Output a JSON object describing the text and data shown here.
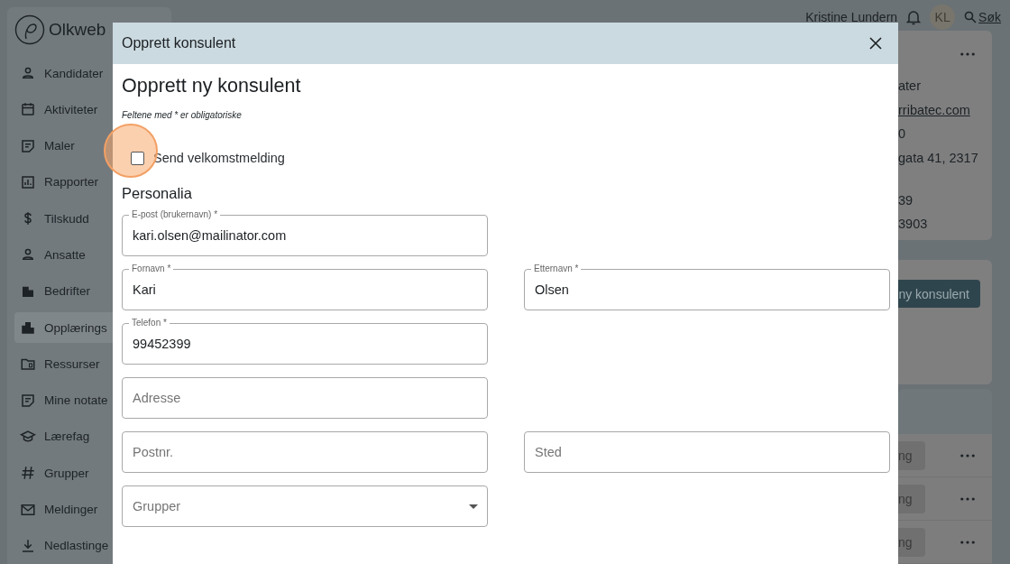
{
  "sidebar": {
    "logo": "Olkweb",
    "items": [
      {
        "label": "Kandidater",
        "selected": false
      },
      {
        "label": "Aktiviteter",
        "selected": false
      },
      {
        "label": "Maler",
        "selected": false
      },
      {
        "label": "Rapporter",
        "selected": false
      },
      {
        "label": "Tilskudd",
        "selected": false
      },
      {
        "label": "Ansatte",
        "selected": false
      },
      {
        "label": "Bedrifter",
        "selected": false
      },
      {
        "label": "Opplærings",
        "selected": true
      },
      {
        "label": "Ressurser",
        "selected": false
      },
      {
        "label": "Mine notate",
        "selected": false
      },
      {
        "label": "Lærefag",
        "selected": false
      },
      {
        "label": "Grupper",
        "selected": false
      },
      {
        "label": "Meldinger",
        "selected": false
      },
      {
        "label": "Nedlastinge",
        "selected": false
      }
    ]
  },
  "header": {
    "user_name": "Kristine Lundern",
    "avatar_initials": "KL",
    "search_link": "Søk"
  },
  "details_card": {
    "lines": [
      {
        "text": "ater",
        "kind": "text"
      },
      {
        "text": "rribatec.com",
        "kind": "link"
      },
      {
        "text": "0",
        "kind": "text"
      },
      {
        "text": "gata 41, 2317",
        "kind": "text"
      },
      {
        "text": "39",
        "kind": "text"
      },
      {
        "text": "3903",
        "kind": "text"
      }
    ]
  },
  "consultants_card": {
    "button": "ny konsulent"
  },
  "list_card": {
    "rows": [
      {
        "action": "ng"
      },
      {
        "action": "ng"
      },
      {
        "action": "ng"
      }
    ]
  },
  "dialog": {
    "title": "Opprett konsulent",
    "heading": "Opprett ny konsulent",
    "required_note": "Feltene med * er obligatoriske",
    "welcome_checkbox": {
      "label": "Send velkomstmelding",
      "checked": false
    },
    "section": "Personalia",
    "rows": [
      {
        "fields": [
          {
            "kind": "text",
            "label": "E-post (brukernavn) *",
            "value": "kari.olsen@mailinator.com"
          }
        ]
      },
      {
        "fields": [
          {
            "kind": "text",
            "label": "Fornavn *",
            "value": "Kari"
          },
          {
            "kind": "text",
            "label": "Etternavn *",
            "value": "Olsen"
          }
        ]
      },
      {
        "fields": [
          {
            "kind": "text",
            "label": "Telefon *",
            "value": "99452399"
          }
        ]
      },
      {
        "fields": [
          {
            "kind": "text",
            "placeholder": "Adresse"
          }
        ]
      },
      {
        "fields": [
          {
            "kind": "text",
            "placeholder": "Postnr."
          },
          {
            "kind": "text",
            "placeholder": "Sted"
          }
        ]
      },
      {
        "fields": [
          {
            "kind": "select",
            "placeholder": "Grupper"
          }
        ]
      }
    ]
  }
}
